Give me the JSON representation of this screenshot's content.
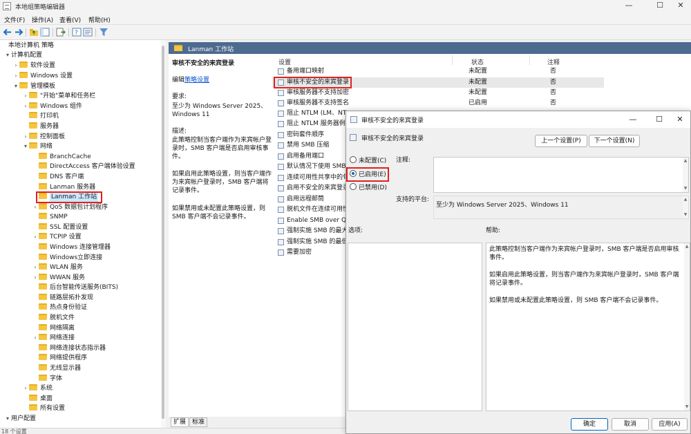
{
  "window": {
    "title": "本地组策略编辑器",
    "minimize_glyph": "—",
    "maximize_glyph": "☐",
    "close_glyph": "✕"
  },
  "menu": {
    "items": [
      "文件(F)",
      "操作(A)",
      "查看(V)",
      "帮助(H)"
    ]
  },
  "toolbar": {
    "icons": [
      "back-icon",
      "forward-icon",
      "up-folder-icon",
      "show-hide-tree-icon",
      "export-list-icon",
      "help-icon",
      "properties-icon",
      "filter-icon"
    ]
  },
  "tree": {
    "items": [
      {
        "label": "本地计算机 策略",
        "arrow": ""
      },
      {
        "label": "计算机配置",
        "arrow": "▾"
      },
      {
        "label": "软件设置",
        "arrow": "›"
      },
      {
        "label": "Windows 设置",
        "arrow": "›"
      },
      {
        "label": "管理模板",
        "arrow": "▾"
      },
      {
        "label": "\"开始\"菜单和任务栏",
        "arrow": "›"
      },
      {
        "label": "Windows 组件",
        "arrow": "›"
      },
      {
        "label": "打印机",
        "arrow": ""
      },
      {
        "label": "服务器",
        "arrow": ""
      },
      {
        "label": "控制面板",
        "arrow": "›"
      },
      {
        "label": "网络",
        "arrow": "▾"
      },
      {
        "label": "BranchCache",
        "arrow": ""
      },
      {
        "label": "DirectAccess 客户端体验设置",
        "arrow": ""
      },
      {
        "label": "DNS 客户端",
        "arrow": ""
      },
      {
        "label": "Lanman 服务器",
        "arrow": ""
      },
      {
        "label": "Lanman 工作站",
        "arrow": ""
      },
      {
        "label": "QoS 数据包计划程序",
        "arrow": "›"
      },
      {
        "label": "SNMP",
        "arrow": ""
      },
      {
        "label": "SSL 配置设置",
        "arrow": ""
      },
      {
        "label": "TCPIP 设置",
        "arrow": "›"
      },
      {
        "label": "Windows 连接管理器",
        "arrow": ""
      },
      {
        "label": "Windows立即连接",
        "arrow": ""
      },
      {
        "label": "WLAN 服务",
        "arrow": "›"
      },
      {
        "label": "WWAN 服务",
        "arrow": "›"
      },
      {
        "label": "后台智能传送服务(BITS)",
        "arrow": ""
      },
      {
        "label": "链路层拓扑发现",
        "arrow": ""
      },
      {
        "label": "热点身份验证",
        "arrow": ""
      },
      {
        "label": "脱机文件",
        "arrow": ""
      },
      {
        "label": "网络隔离",
        "arrow": ""
      },
      {
        "label": "网络连接",
        "arrow": "›"
      },
      {
        "label": "网络连接状态指示器",
        "arrow": ""
      },
      {
        "label": "网络提供程序",
        "arrow": ""
      },
      {
        "label": "无线显示器",
        "arrow": ""
      },
      {
        "label": "字体",
        "arrow": ""
      },
      {
        "label": "系统",
        "arrow": "›"
      },
      {
        "label": "桌面",
        "arrow": ""
      },
      {
        "label": "所有设置",
        "arrow": ""
      },
      {
        "label": "用户配置",
        "arrow": "▾"
      }
    ]
  },
  "right": {
    "header": "Lanman 工作站",
    "desc": {
      "title": "审核不安全的来宾登录",
      "edit_prefix": "编辑",
      "edit_link": "策略设置",
      "req_label": "要求:",
      "req_text": "至少为 Windows Server 2025、Windows 11",
      "desc_label": "描述:",
      "p1": "此策略控制当客户端作为来宾帐户登录时，SMB 客户端是否启用审核事件。",
      "p2": "如果启用此策略设置，则当客户端作为来宾帐户登录时，SMB 客户端将记录事件。",
      "p3": "如果禁用或未配置此策略设置，则 SMB 客户端不会记录事件。"
    },
    "columns": {
      "setting": "设置",
      "state": "状态",
      "comment": "注释"
    },
    "rows": [
      {
        "name": "备用端口映射",
        "state": "未配置",
        "comment": "否"
      },
      {
        "name": "审核不安全的来宾登录",
        "state": "未配置",
        "comment": "否"
      },
      {
        "name": "审核服务器不支持加密",
        "state": "未配置",
        "comment": "否"
      },
      {
        "name": "审核服务器不支持签名",
        "state": "已启用",
        "comment": "否"
      },
      {
        "name": "阻止 NTLM (LM、NT",
        "state": "",
        "comment": ""
      },
      {
        "name": "阻止 NTLM 服务器例",
        "state": "",
        "comment": ""
      },
      {
        "name": "密码套件顺序",
        "state": "",
        "comment": ""
      },
      {
        "name": "禁用 SMB 压缩",
        "state": "",
        "comment": ""
      },
      {
        "name": "启用备用端口",
        "state": "",
        "comment": ""
      },
      {
        "name": "默认情况下使用 SMB",
        "state": "",
        "comment": ""
      },
      {
        "name": "连续可用性共享中的句",
        "state": "",
        "comment": ""
      },
      {
        "name": "启用不安全的来宾登录",
        "state": "",
        "comment": ""
      },
      {
        "name": "启用远程邮筒",
        "state": "",
        "comment": ""
      },
      {
        "name": "脱机文件在连续可用性",
        "state": "",
        "comment": ""
      },
      {
        "name": "Enable SMB over QU",
        "state": "",
        "comment": ""
      },
      {
        "name": "强制实施 SMB 的最大",
        "state": "",
        "comment": ""
      },
      {
        "name": "强制实施 SMB 的最低",
        "state": "",
        "comment": ""
      },
      {
        "name": "需要加密",
        "state": "",
        "comment": ""
      }
    ],
    "tabs": [
      "扩展",
      "标准"
    ]
  },
  "status": "18 个设置",
  "dialog": {
    "title": "审核不安全的来宾登录",
    "header_name": "审核不安全的来宾登录",
    "prev_btn": "上一个设置(P)",
    "next_btn": "下一个设置(N)",
    "radio_notconfigured": "未配置(C)",
    "radio_enabled": "已启用(E)",
    "radio_disabled": "已禁用(D)",
    "comment_label": "注释:",
    "platform_label": "支持的平台:",
    "platform_text": "至少为 Windows Server 2025、Windows 11",
    "options_label": "选项:",
    "help_label": "帮助:",
    "help_p1": "此策略控制当客户端作为来宾帐户登录时，SMB 客户端是否启用审核事件。",
    "help_p2": "如果启用此策略设置，则当客户端作为来宾帐户登录时，SMB 客户端将记录事件。",
    "help_p3": "如果禁用或未配置此策略设置，则 SMB 客户端不会记录事件。",
    "ok": "确定",
    "cancel": "取消",
    "apply": "应用(A)",
    "selected": "enabled"
  },
  "colors": {
    "header_bar": "#4d6a8f",
    "highlight_box": "#e02020",
    "accent": "#0067c0"
  }
}
